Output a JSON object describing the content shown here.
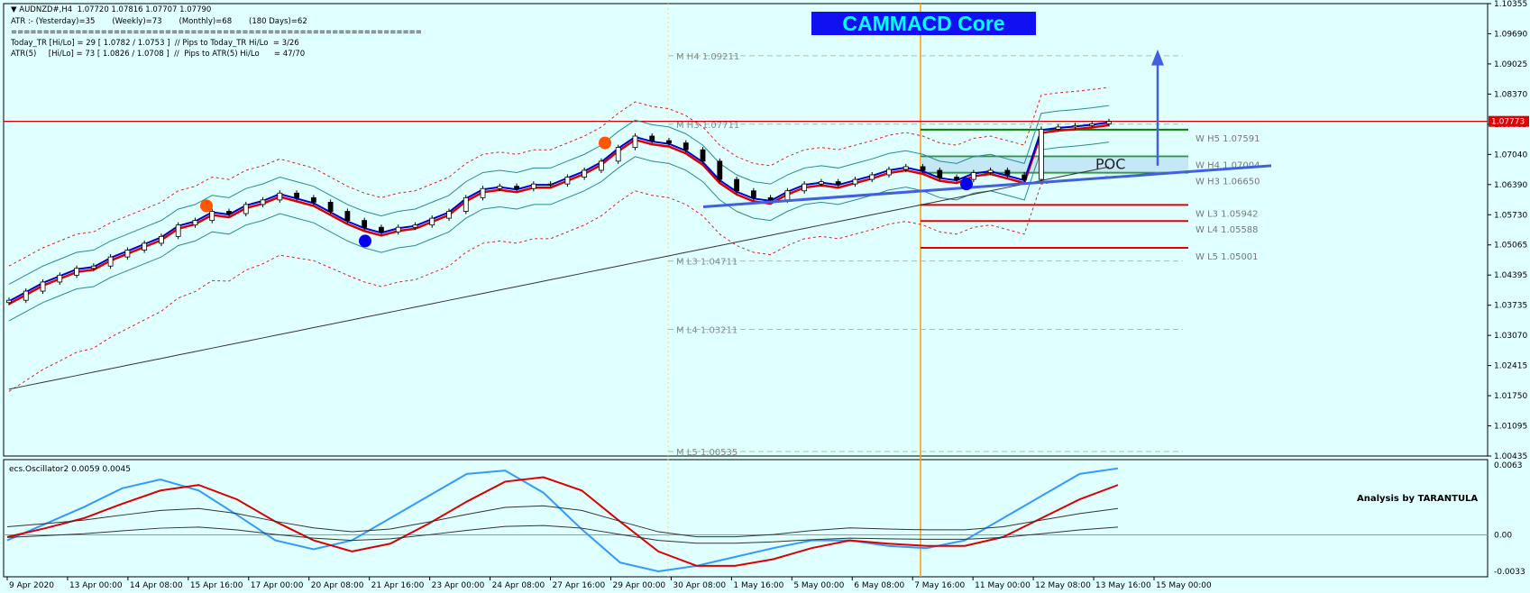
{
  "header": {
    "symbol_line": "AUDNZD#,H4  1.07720 1.07816 1.07707 1.07790",
    "atr_line": "ATR :- (Yesterday)=35       (Weekly)=73       (Monthly)=68       (180 Days)=62",
    "separator": "================================================================",
    "today_tr_line": "Today_TR [Hi/Lo] = 29 [ 1.0782 / 1.0753 ]  // Pips to Today_TR Hi/Lo  = 3/26",
    "atr5_line": "ATR(5)     [Hi/Lo] = 73 [ 1.0826 / 1.0708 ]  //  Pips to ATR(5) Hi/Lo      = 47/70"
  },
  "badge": {
    "text": "CAMMACD Core"
  },
  "chart_data": {
    "type": "candlestick",
    "symbol": "AUDNZD#",
    "timeframe": "H4",
    "ohlc_last": {
      "open": 1.0772,
      "high": 1.07816,
      "low": 1.07707,
      "close": 1.0779
    },
    "current_price_label": "1.07773",
    "current_price": 1.07773,
    "ylim": [
      1.00435,
      1.10355
    ],
    "y_ticks": [
      "1.10355",
      "1.09690",
      "1.09025",
      "1.08370",
      "1.07705",
      "1.07040",
      "1.06390",
      "1.05730",
      "1.05065",
      "1.04395",
      "1.03735",
      "1.03070",
      "1.02415",
      "1.01750",
      "1.01095",
      "1.00435"
    ],
    "x_ticks": [
      "9 Apr 2020",
      "13 Apr 00:00",
      "14 Apr 08:00",
      "15 Apr 16:00",
      "17 Apr 00:00",
      "20 Apr 08:00",
      "21 Apr 16:00",
      "23 Apr 00:00",
      "24 Apr 08:00",
      "27 Apr 16:00",
      "29 Apr 00:00",
      "30 Apr 08:00",
      "1 May 16:00",
      "5 May 00:00",
      "6 May 08:00",
      "7 May 16:00",
      "11 May 00:00",
      "12 May 08:00",
      "13 May 16:00",
      "15 May 00:00"
    ],
    "monthly_pivots": [
      {
        "label": "M  H4 1.09211",
        "value": 1.09211
      },
      {
        "label": "M  H3 1.07711",
        "value": 1.07711
      },
      {
        "label": "M  L3 1.04711",
        "value": 1.04711
      },
      {
        "label": "M  L4 1.03211",
        "value": 1.03211
      },
      {
        "label": "M  L5 1.00535",
        "value": 1.00535
      }
    ],
    "weekly_pivots": [
      {
        "label": "W  H5 1.07591",
        "value": 1.07591,
        "color": "#008000"
      },
      {
        "label": "W  H4 1.07004",
        "value": 1.07004,
        "color": "#008000"
      },
      {
        "label": "W  H3 1.06650",
        "value": 1.0665,
        "color": "#008000"
      },
      {
        "label": "W  L3 1.05942",
        "value": 1.05942,
        "color": "#e00000"
      },
      {
        "label": "W  L4 1.05588",
        "value": 1.05588,
        "color": "#e00000"
      },
      {
        "label": "W  L5 1.05001",
        "value": 1.05001,
        "color": "#e00000"
      }
    ],
    "poc_label": "POC",
    "close_series": [
      1.0385,
      1.0405,
      1.0425,
      1.044,
      1.0455,
      1.046,
      1.048,
      1.0495,
      1.051,
      1.0525,
      1.055,
      1.056,
      1.058,
      1.0575,
      1.0595,
      1.0605,
      1.062,
      1.061,
      1.06,
      1.058,
      1.056,
      1.0545,
      1.0535,
      1.0545,
      1.055,
      1.0565,
      1.058,
      1.061,
      1.063,
      1.0635,
      1.063,
      1.064,
      1.064,
      1.0655,
      1.067,
      1.069,
      1.072,
      1.0745,
      1.0735,
      1.073,
      1.0715,
      1.069,
      1.065,
      1.0625,
      1.061,
      1.0605,
      1.0625,
      1.064,
      1.0645,
      1.064,
      1.065,
      1.066,
      1.0672,
      1.0678,
      1.067,
      1.0655,
      1.065,
      1.0665,
      1.067,
      1.066,
      1.065,
      1.076,
      1.0765,
      1.0768,
      1.0772,
      1.0777
    ],
    "oscillator": {
      "name": "ecs.Oscillator2",
      "label": "ecs.Oscillator2 0.0059 0.0045",
      "ylim": [
        -0.0033,
        0.0063
      ],
      "y_ticks": [
        "0.0063",
        "0.00",
        "-0.0033"
      ],
      "blue": [
        -0.0005,
        0.001,
        0.0025,
        0.0042,
        0.005,
        0.004,
        0.0018,
        -0.0005,
        -0.0013,
        -0.0005,
        0.0015,
        0.0035,
        0.0055,
        0.0058,
        0.0038,
        0.0005,
        -0.0025,
        -0.0033,
        -0.0028,
        -0.002,
        -0.0012,
        -0.0005,
        -0.0005,
        -0.001,
        -0.0012,
        -0.0005,
        0.0015,
        0.0035,
        0.0055,
        0.006
      ],
      "red": [
        -0.0002,
        0.0006,
        0.0015,
        0.0028,
        0.004,
        0.0045,
        0.0032,
        0.0012,
        -0.0005,
        -0.0015,
        -0.0008,
        0.001,
        0.003,
        0.0048,
        0.0052,
        0.004,
        0.0012,
        -0.0015,
        -0.0028,
        -0.0028,
        -0.0022,
        -0.0012,
        -0.0005,
        -0.0008,
        -0.001,
        -0.001,
        -0.0002,
        0.0015,
        0.0032,
        0.0045
      ]
    }
  },
  "analysis_label": "Analysis by TARANTULA",
  "colors": {
    "background": "#e0ffff",
    "price_line": "#cc0000",
    "blue_line": "#0000cc",
    "red_line": "#dd0000",
    "vline": "#ff9900"
  }
}
